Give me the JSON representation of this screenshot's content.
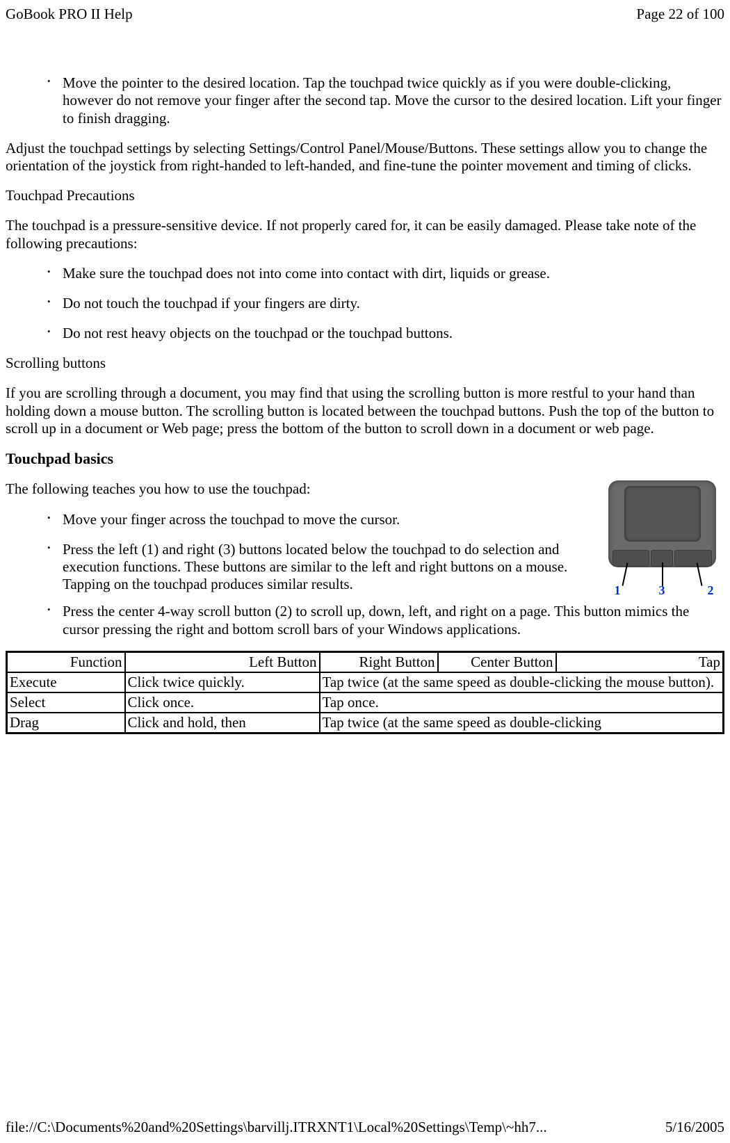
{
  "header": {
    "title": "GoBook PRO II Help",
    "page_number": "Page 22 of 100"
  },
  "section1": {
    "bullet1": "Move the pointer to the desired location. Tap the touchpad twice quickly as if you were double-clicking, however do not remove your finger after the second tap. Move the cursor to the desired location. Lift your finger to finish dragging.",
    "para1": "Adjust the touchpad settings by selecting Settings/Control Panel/Mouse/Buttons. These settings allow you to change the orientation of the joystick from right-handed to left-handed, and fine-tune the pointer movement and timing of clicks.",
    "precautions_heading": "Touchpad Precautions",
    "precautions_intro": "The touchpad is a pressure-sensitive device.  If not properly cared for, it can be easily damaged.  Please take note of the following precautions:",
    "precautions": [
      "Make sure the touchpad does not into come into contact with dirt, liquids or grease.",
      "Do not touch the touchpad if your fingers are dirty.",
      "Do not rest heavy objects on the touchpad or the touchpad buttons."
    ],
    "scrolling_heading": "Scrolling buttons",
    "scrolling_para": "If you are scrolling through a document, you may find that using the scrolling button is more restful to your hand than holding down a mouse button.  The scrolling button is located between the touchpad buttons.  Push the top of the button to scroll up in a document or Web page; press the bottom of the button to scroll down in a document or web page."
  },
  "section2": {
    "heading": "Touchpad basics",
    "intro": "The following teaches you how to use the touchpad:",
    "bullets": [
      "Move your finger across the touchpad to move the cursor.",
      "Press the left (1) and right (3) buttons located below the touchpad to do selection and execution functions. These buttons are similar to the left and right buttons on a mouse. Tapping on the touchpad produces similar results.",
      "Press the center 4-way scroll button (2) to scroll up, down, left, and right on a page. This button mimics the cursor pressing the right and bottom scroll bars of your Windows applications."
    ],
    "image_labels": {
      "left": "1",
      "center": "3",
      "right": "2"
    }
  },
  "table": {
    "headers": [
      "Function",
      "Left Button",
      "Right Button",
      "Center Button",
      "Tap"
    ],
    "rows": [
      {
        "function": "Execute",
        "left": "Click twice quickly.",
        "right": "Tap twice (at the same speed as double-clicking the mouse button)."
      },
      {
        "function": "Select",
        "left": "Click once.",
        "right": "Tap once."
      },
      {
        "function": "Drag",
        "left": "Click and hold, then",
        "right": "Tap twice (at the same speed as double-clicking"
      }
    ]
  },
  "footer": {
    "path": "file://C:\\Documents%20and%20Settings\\barvillj.ITRXNT1\\Local%20Settings\\Temp\\~hh7...",
    "date": "5/16/2005"
  }
}
